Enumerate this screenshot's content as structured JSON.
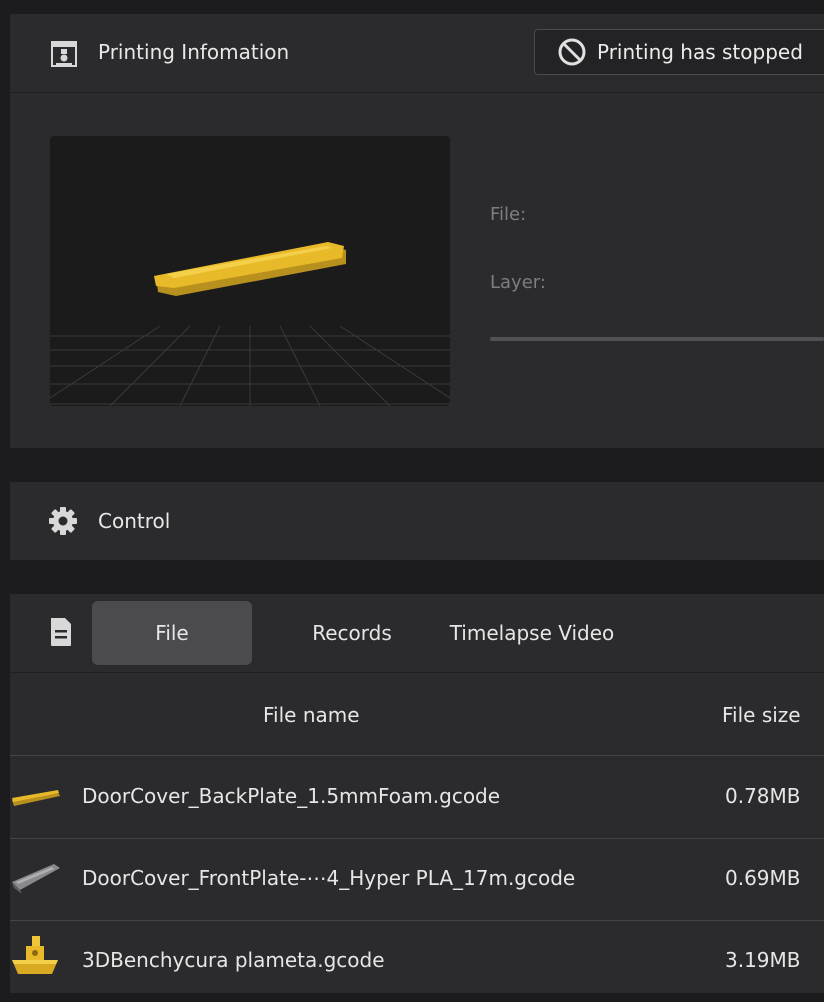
{
  "printing_info": {
    "title": "Printing Infomation",
    "status": "Printing has stopped",
    "file_label": "File:",
    "layer_label": "Layer:",
    "progress_percent": 0
  },
  "control": {
    "title": "Control"
  },
  "files_panel": {
    "tabs": [
      {
        "label": "File",
        "active": true
      },
      {
        "label": "Records",
        "active": false
      },
      {
        "label": "Timelapse Video",
        "active": false
      }
    ],
    "columns": {
      "name": "File name",
      "size": "File size"
    },
    "rows": [
      {
        "name": "DoorCover_BackPlate_1.5mmFoam.gcode",
        "size": "0.78MB",
        "thumb": "yellow-plate"
      },
      {
        "name": "DoorCover_FrontPlate-⋯4_Hyper PLA_17m.gcode",
        "size": "0.69MB",
        "thumb": "grey-plate"
      },
      {
        "name": "3DBenchycura plameta.gcode",
        "size": "3.19MB",
        "thumb": "yellow-boat"
      }
    ]
  },
  "colors": {
    "model_yellow": "#e8b928",
    "panel_bg": "#2b2b2e",
    "page_bg": "#1c1c1e"
  }
}
